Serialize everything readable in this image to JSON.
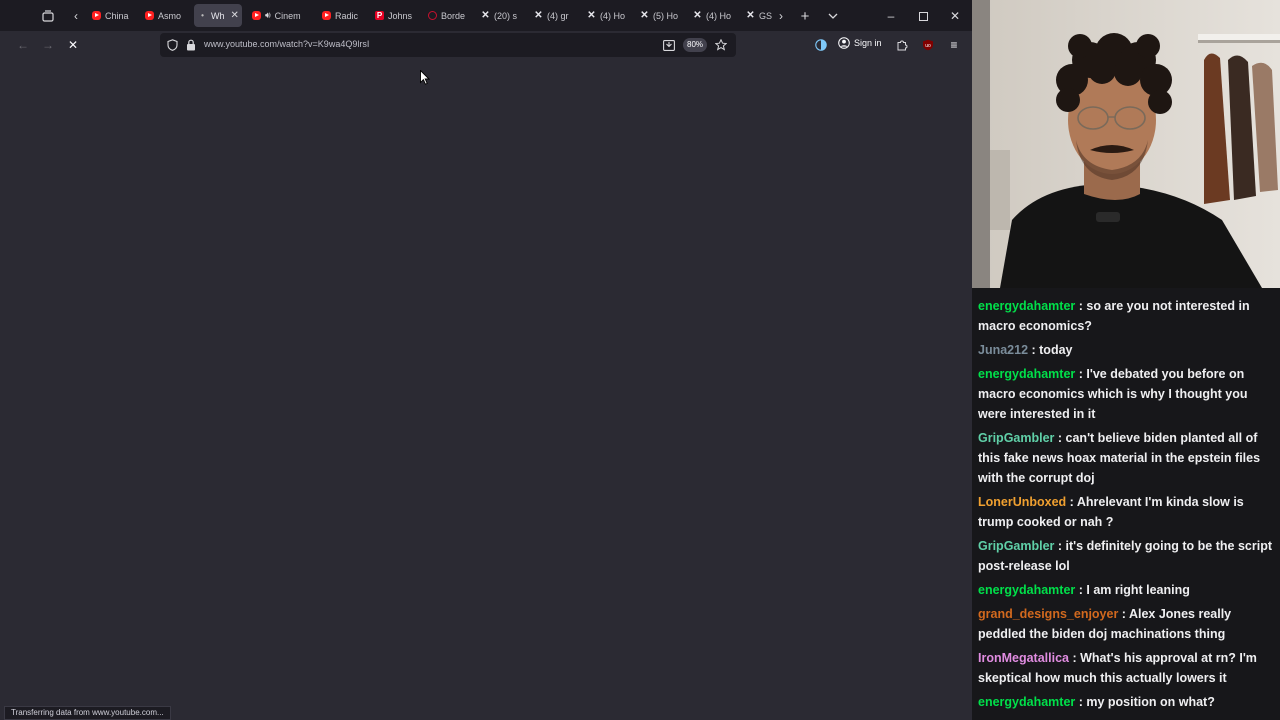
{
  "tabs": [
    {
      "label": "China",
      "favicon": "youtube-favicon",
      "active": false
    },
    {
      "label": "Asmo",
      "favicon": "youtube-favicon",
      "active": false
    },
    {
      "label": "Wh",
      "favicon": "loading-favicon",
      "active": true
    },
    {
      "label": "Cinem",
      "favicon": "youtube-favicon",
      "active": false,
      "playing_audio": true
    },
    {
      "label": "Radic",
      "favicon": "youtube-favicon",
      "active": false
    },
    {
      "label": "Johns",
      "favicon": "p-favicon",
      "active": false
    },
    {
      "label": "Borde",
      "favicon": "ring-favicon",
      "active": false
    },
    {
      "label": "(20) s",
      "favicon": "x-favicon",
      "active": false
    },
    {
      "label": "(4) gr",
      "favicon": "x-favicon",
      "active": false
    },
    {
      "label": "(4) Ho",
      "favicon": "x-favicon",
      "active": false
    },
    {
      "label": "(5) Ho",
      "favicon": "x-favicon",
      "active": false
    },
    {
      "label": "(4) Ho",
      "favicon": "x-favicon",
      "active": false
    },
    {
      "label": "GS",
      "favicon": "x-favicon",
      "active": false
    }
  ],
  "navbar": {
    "url": "www.youtube.com/watch?v=K9wa4Q9lrsI",
    "zoom": "80%",
    "signin_label": "Sign in"
  },
  "status_text": "Transferring data from www.youtube.com...",
  "chat": [
    {
      "user": "energydahamter",
      "color": "#00e04a",
      "text": " : so are you not interested in macro economics?"
    },
    {
      "user": "Juna212",
      "color": "#7a8c9a",
      "text": " : today"
    },
    {
      "user": "energydahamter",
      "color": "#00e04a",
      "text": " : I've debated you before on macro economics which is why I thought you were interested in it"
    },
    {
      "user": "GripGambler",
      "color": "#60d0a8",
      "text": " : can't believe biden planted all of this fake news hoax material in the epstein files with the corrupt doj"
    },
    {
      "user": "LonerUnboxed",
      "color": "#f0a030",
      "text": " : Ahrelevant I'm kinda slow is trump cooked or nah ?"
    },
    {
      "user": "GripGambler",
      "color": "#60d0a8",
      "text": " : it's definitely going to be the script post-release lol"
    },
    {
      "user": "energydahamter",
      "color": "#00e04a",
      "text": " : I am right leaning"
    },
    {
      "user": "grand_designs_enjoyer",
      "color": "#d2691e",
      "text": " : Alex Jones really peddled the biden doj machinations thing"
    },
    {
      "user": "IronMegatallica",
      "color": "#e08ce0",
      "text": " : What's his approval at rn? I'm skeptical how much this actually lowers it"
    },
    {
      "user": "energydahamter",
      "color": "#00e04a",
      "text": " : my position on what?"
    }
  ]
}
